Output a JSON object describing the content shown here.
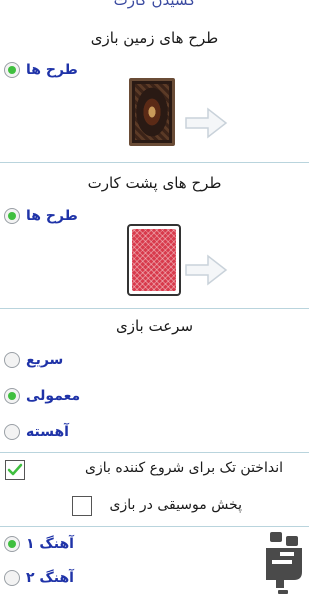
{
  "top_cut_label": "کشیدن کارت",
  "board_design": {
    "title": "طرح های زمین بازی",
    "option_label": "طرح ها",
    "selected": true,
    "preview_icon": "carpet-preview-icon",
    "arrow_icon": "arrow-right-icon"
  },
  "card_back_design": {
    "title": "طرح های پشت کارت",
    "option_label": "طرح ها",
    "selected": true,
    "preview_icon": "card-back-preview-icon",
    "arrow_icon": "arrow-right-icon"
  },
  "game_speed": {
    "title": "سرعت بازی",
    "options": [
      {
        "label": "سریع",
        "selected": false
      },
      {
        "label": "معمولی",
        "selected": true
      },
      {
        "label": "آهسته",
        "selected": false
      }
    ]
  },
  "settings": {
    "first_player_toss": {
      "label": "انداختن تک برای شروع کننده بازی",
      "checked": true
    },
    "music": {
      "label": "پخش موسیقی در بازی",
      "checked": false
    }
  },
  "songs": [
    {
      "label": "آهنگ ۱",
      "selected": true
    },
    {
      "label": "آهنگ ۲",
      "selected": false
    }
  ],
  "watermark_icon": "app-logo-icon",
  "colors": {
    "option_text": "#1f33a8",
    "radio_selected": "#3fbf3f",
    "divider": "#b9d4dd"
  }
}
